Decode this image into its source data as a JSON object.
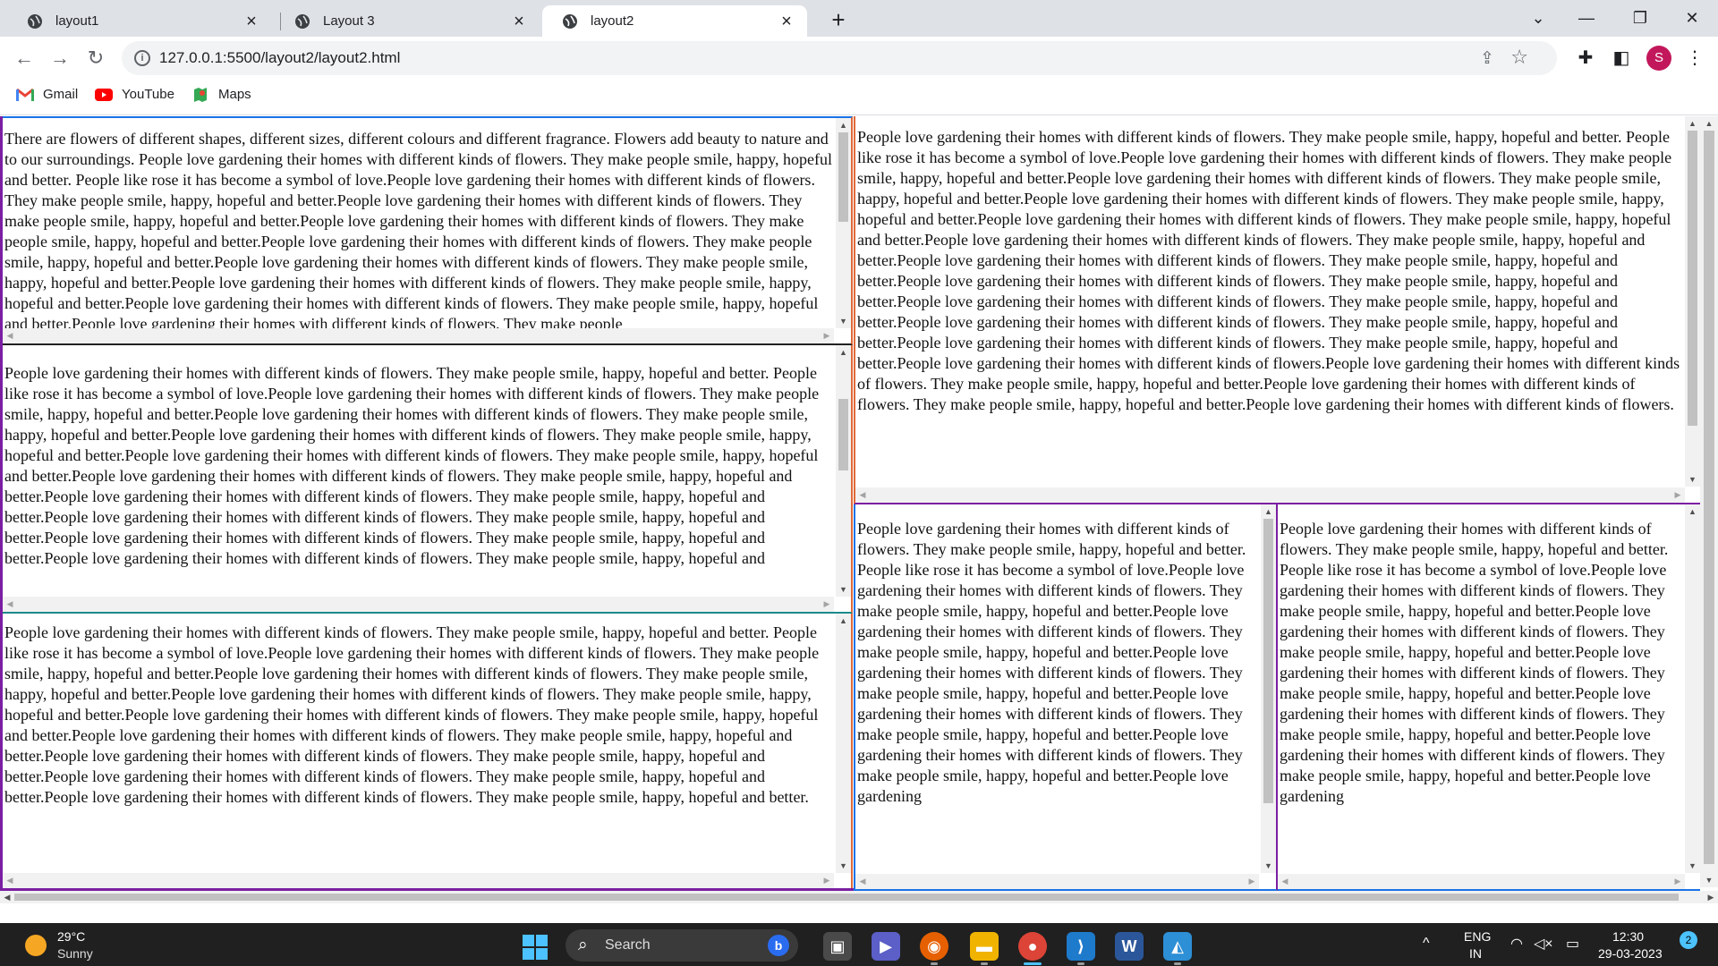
{
  "browser": {
    "tabs": [
      {
        "title": "layout1",
        "active": false
      },
      {
        "title": "Layout 3",
        "active": false
      },
      {
        "title": "layout2",
        "active": true
      }
    ],
    "url": "127.0.0.1:5500/layout2/layout2.html",
    "profile_initial": "S",
    "bookmarks": [
      {
        "label": "Gmail",
        "icon": "gmail-icon"
      },
      {
        "label": "YouTube",
        "icon": "youtube-icon"
      },
      {
        "label": "Maps",
        "icon": "maps-icon"
      }
    ]
  },
  "page": {
    "panels": [
      {
        "id": "left-top",
        "text": "There are flowers of different shapes, different sizes, different colours and different fragrance. Flowers add beauty to nature and to our surroundings. People love gardening their homes with different kinds of flowers. They make people smile, happy, hopeful and better. People like rose it has become a symbol of love.People love gardening their homes with different kinds of flowers. They make people smile, happy, hopeful and better.People love gardening their homes with different kinds of flowers. They make people smile, happy, hopeful and better.People love gardening their homes with different kinds of flowers. They make people smile, happy, hopeful and better.People love gardening their homes with different kinds of flowers. They make people smile, happy, hopeful and better.People love gardening their homes with different kinds of flowers. They make people smile, happy, hopeful and better.People love gardening their homes with different kinds of flowers. They make people smile, happy, hopeful and better.People love gardening their homes with different kinds of flowers. They make people smile, happy, hopeful and better.People love gardening their homes with different kinds of flowers. They make people"
      },
      {
        "id": "left-middle",
        "text": "People love gardening their homes with different kinds of flowers. They make people smile, happy, hopeful and better. People like rose it has become a symbol of love.People love gardening their homes with different kinds of flowers. They make people smile, happy, hopeful and better.People love gardening their homes with different kinds of flowers. They make people smile, happy, hopeful and better.People love gardening their homes with different kinds of flowers. They make people smile, happy, hopeful and better.People love gardening their homes with different kinds of flowers. They make people smile, happy, hopeful and better.People love gardening their homes with different kinds of flowers. They make people smile, happy, hopeful and better.People love gardening their homes with different kinds of flowers. They make people smile, happy, hopeful and better.People love gardening their homes with different kinds of flowers. They make people smile, happy, hopeful and better.People love gardening their homes with different kinds of flowers. They make people smile, happy, hopeful and better.People love gardening their homes with different kinds of flowers. They make people smile, happy, hopeful and"
      },
      {
        "id": "left-bottom",
        "text": "People love gardening their homes with different kinds of flowers. They make people smile, happy, hopeful and better. People like rose it has become a symbol of love.People love gardening their homes with different kinds of flowers. They make people smile, happy, hopeful and better.People love gardening their homes with different kinds of flowers. They make people smile, happy, hopeful and better.People love gardening their homes with different kinds of flowers. They make people smile, happy, hopeful and better.People love gardening their homes with different kinds of flowers. They make people smile, happy, hopeful and better.People love gardening their homes with different kinds of flowers. They make people smile, happy, hopeful and better.People love gardening their homes with different kinds of flowers. They make people smile, happy, hopeful and better.People love gardening their homes with different kinds of flowers. They make people smile, happy, hopeful and better.People love gardening their homes with different kinds of flowers. They make people smile, happy, hopeful and better."
      },
      {
        "id": "right-top",
        "text": "People love gardening their homes with different kinds of flowers. They make people smile, happy, hopeful and better. People like rose it has become a symbol of love.People love gardening their homes with different kinds of flowers. They make people smile, happy, hopeful and better.People love gardening their homes with different kinds of flowers. They make people smile, happy, hopeful and better.People love gardening their homes with different kinds of flowers. They make people smile, happy, hopeful and better.People love gardening their homes with different kinds of flowers. They make people smile, happy, hopeful and better.People love gardening their homes with different kinds of flowers. They make people smile, happy, hopeful and better.People love gardening their homes with different kinds of flowers. They make people smile, happy, hopeful and better.People love gardening their homes with different kinds of flowers. They make people smile, happy, hopeful and better.People love gardening their homes with different kinds of flowers. They make people smile, happy, hopeful and better.People love gardening their homes with different kinds of flowers. They make people smile, happy, hopeful and better.People love gardening their homes with different kinds of flowers. They make people smile, happy, hopeful and better.People love gardening their homes with different kinds of flowers.People love gardening their homes with different kinds of flowers. They make people smile, happy, hopeful and better.People love gardening their homes with different kinds of flowers. They make people smile, happy, hopeful and better.People love gardening their homes with different kinds of flowers."
      },
      {
        "id": "right-bottom-left",
        "text": "People love gardening their homes with different kinds of flowers. They make people smile, happy, hopeful and better. People like rose it has become a symbol of love.People love gardening their homes with different kinds of flowers. They make people smile, happy, hopeful and better.People love gardening their homes with different kinds of flowers. They make people smile, happy, hopeful and better.People love gardening their homes with different kinds of flowers. They make people smile, happy, hopeful and better.People love gardening their homes with different kinds of flowers. They make people smile, happy, hopeful and better.People love gardening their homes with different kinds of flowers. They make people smile, happy, hopeful and better.People love gardening"
      },
      {
        "id": "right-bottom-right",
        "text": "People love gardening their homes with different kinds of flowers. They make people smile, happy, hopeful and better. People like rose it has become a symbol of love.People love gardening their homes with different kinds of flowers. They make people smile, happy, hopeful and better.People love gardening their homes with different kinds of flowers. They make people smile, happy, hopeful and better.People love gardening their homes with different kinds of flowers. They make people smile, happy, hopeful and better.People love gardening their homes with different kinds of flowers. They make people smile, happy, hopeful and better.People love gardening their homes with different kinds of flowers. They make people smile, happy, hopeful and better.People love gardening"
      }
    ]
  },
  "taskbar": {
    "weather_temp": "29°C",
    "weather_condition": "Sunny",
    "search_label": "Search",
    "language_line1": "ENG",
    "language_line2": "IN",
    "time": "12:30",
    "date": "29-03-2023",
    "notification_count": "2"
  },
  "colors": {
    "tabstrip": "#dee1e6",
    "taskbar": "#202020",
    "border_blue": "#1a73e8",
    "border_orange": "#e0693a",
    "border_purple": "#7b1fa2",
    "border_teal": "#1b8a8a"
  }
}
